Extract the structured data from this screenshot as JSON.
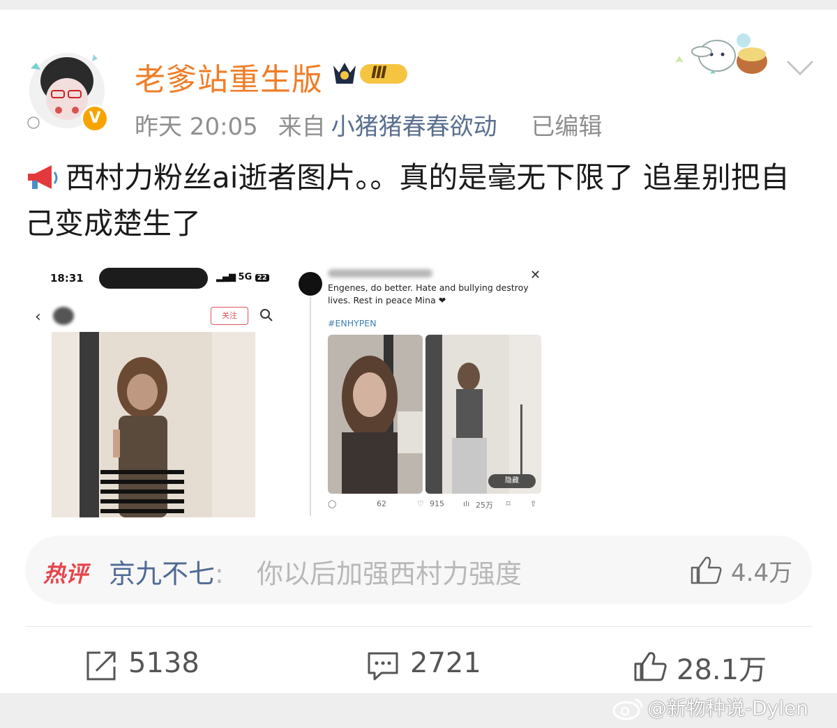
{
  "post": {
    "username": "老爹站重生版",
    "rank_badge": "Ⅲ",
    "verified_mark": "V",
    "time": "昨天 20:05",
    "source_prefix": "来自",
    "source": "小猪猪春春欲动",
    "edited": "已编辑",
    "text": "西村力粉丝ai逝者图片。。真的是毫无下限了 追星别把自己变成楚生了"
  },
  "image_left": {
    "time": "18:31",
    "signal": "5G",
    "battery": "22",
    "follow_label": "关注"
  },
  "image_right": {
    "tweet_text": "Engenes, do better. Hate and bullying destroy lives. Rest in peace Mina ❤",
    "hashtag": "#ENHYPEN",
    "hide_chip": "隐藏",
    "retweets": "62",
    "likes": "915",
    "views": "25万"
  },
  "hot_comment": {
    "tag": "热评",
    "user": "京九不七",
    "separator": ":",
    "text": "你以后加强西村力强度",
    "likes": "4.4万"
  },
  "actions": {
    "share_count": "5138",
    "comment_count": "2721",
    "like_count": "28.1万"
  },
  "watermark": "@新物种说-Dylen",
  "colors": {
    "username": "#f07d27",
    "link": "#5a6f8f",
    "hot_tag": "#e5464c",
    "verified": "#f7a400"
  },
  "icons": [
    "megaphone-icon",
    "chevron-down-icon",
    "share-icon",
    "comment-icon",
    "like-icon",
    "weibo-logo-icon"
  ]
}
